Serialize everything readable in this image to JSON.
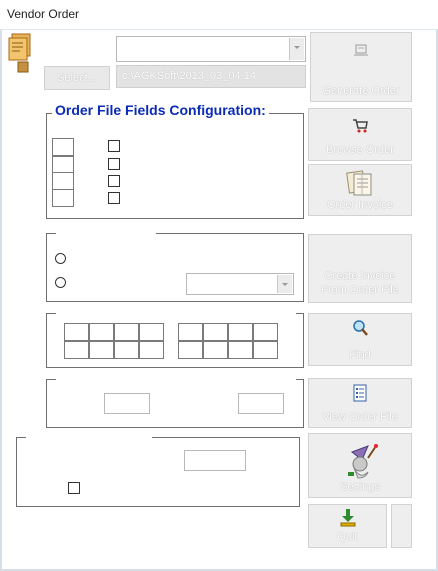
{
  "window": {
    "title": "Vendor Order"
  },
  "top": {
    "select_button_label": "Select...",
    "file_path": "c:\\AGKSoft\\2013_03_04 14",
    "vendor_combo_value": ""
  },
  "fields_config": {
    "label": "Order File Fields Configuration:"
  },
  "buttons": {
    "generate_order": "Generate Order",
    "browse_order": "Browse Order",
    "order_invoice": "Order Invoice",
    "create_invoice_line1": "Create Invoice",
    "create_invoice_line2": "From Order File",
    "find": "Find",
    "view_order_file": "View Order File",
    "settings": "Settings",
    "quit": "Quit",
    "small_extra": ""
  },
  "icons": {
    "app": "app-document-icon",
    "generate_order": "register-icon",
    "browse_order": "cart-icon",
    "order_invoice": "documents-icon",
    "find": "magnifier-icon",
    "view_order_file": "list-icon",
    "settings": "wizard-icon",
    "quit": "exit-arrow-icon"
  },
  "colors": {
    "group_title": "#0a2bb5",
    "disabled_button_bg": "#eeeeee",
    "quit_icon": "#2e8b2e"
  }
}
